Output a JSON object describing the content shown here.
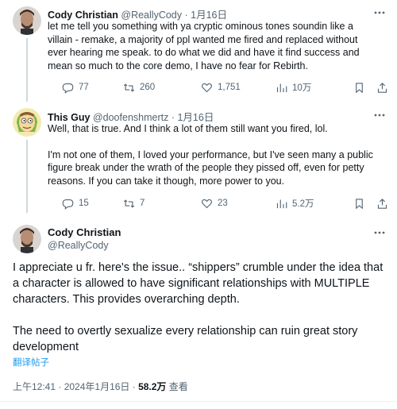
{
  "tweet1": {
    "name": "Cody Christian",
    "handle": "@ReallyCody",
    "sep": "·",
    "date": "1月16日",
    "text": "let me tell you something with ya cryptic ominous tones soundin like a villain - remake, a majority of ppl wanted me fired and replaced without ever hearing me speak. to do what we did and have it find success and mean so much to the core demo, I have no fear for Rebirth.",
    "replies": "77",
    "retweets": "260",
    "likes": "1,751",
    "views": "10万"
  },
  "tweet2": {
    "name": "This Guy",
    "handle": "@doofenshmertz",
    "sep": "·",
    "date": "1月16日",
    "para1": "Well, that is true. And I think a lot of them still want you fired, lol.",
    "para2": "I'm not one of them, I loved your performance, but I've seen many a public figure break under the wrath of the people they pissed off, even for petty reasons. If you can take it though, more power to you.",
    "replies": "15",
    "retweets": "7",
    "likes": "23",
    "views": "5.2万"
  },
  "main": {
    "name": "Cody Christian",
    "handle": "@ReallyCody",
    "para1": "I appreciate u fr. here's the issue.. “shippers” crumble under the idea that a character is allowed to have significant relationships with MULTIPLE characters. This provides overarching depth.",
    "para2": "The need to overtly sexualize every relationship can ruin great story development",
    "translate": "翻译帖子",
    "time": "上午12:41 · 2024年1月16日 · ",
    "views_count": "58.2万",
    "views_label": " 查看"
  },
  "colors": {
    "text": "#0f1419",
    "muted": "#536471",
    "link": "#1d9bf0",
    "thread_line": "#cfd9de",
    "divider": "#eff3f4"
  },
  "icons": [
    "reply-icon",
    "retweet-icon",
    "like-icon",
    "views-icon",
    "bookmark-icon",
    "share-icon",
    "more-icon"
  ]
}
